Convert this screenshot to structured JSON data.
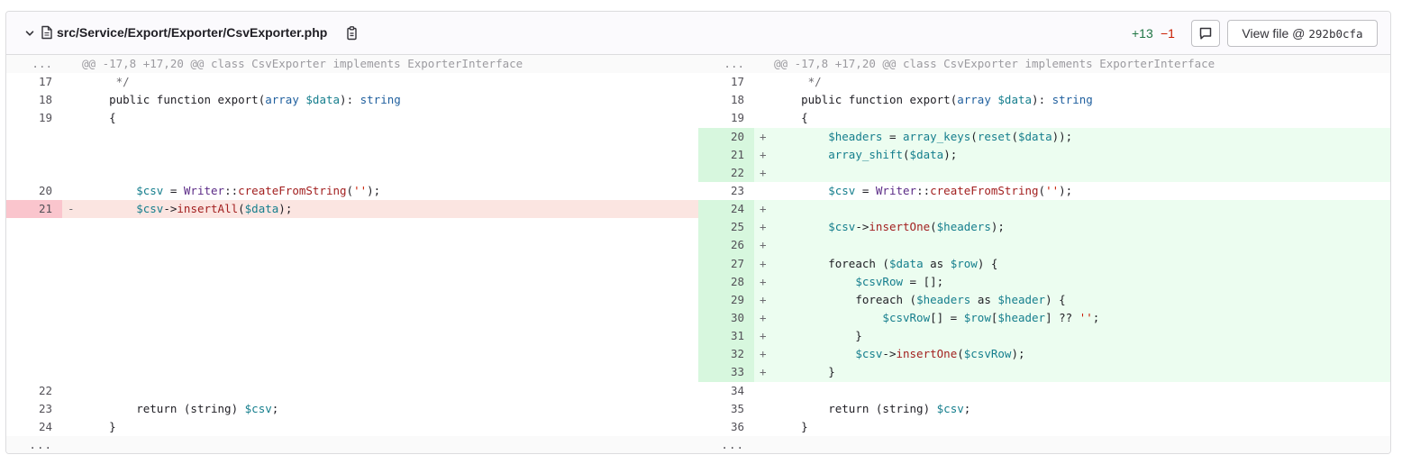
{
  "file": {
    "path": "src/Service/Export/Exporter/CsvExporter.php",
    "additions": "+13",
    "deletions": "−1",
    "view_file_label": "View file @",
    "view_file_sha": "292b0cfa",
    "icons": {
      "collapse": "chevron-down-icon",
      "file": "file-icon",
      "copy": "copy-to-clipboard-icon",
      "comment": "comment-icon"
    }
  },
  "colors": {
    "added_bg": "#ecfdf0",
    "added_line_bg": "#d7f7de",
    "removed_bg": "#fbe5e1",
    "removed_line_bg": "#fac5cd",
    "add_stat": "#217645",
    "del_stat": "#c91c00"
  },
  "hunk": {
    "ellipsis": "...",
    "header": "@@ -17,8 +17,20 @@ class CsvExporter implements ExporterInterface"
  },
  "rows": [
    {
      "type": "ctx",
      "old_num": "17",
      "new_num": "17",
      "old_tokens": [
        [
          "cm",
          "     */"
        ]
      ],
      "new_tokens": [
        [
          "cm",
          "     */"
        ]
      ]
    },
    {
      "type": "ctx",
      "old_num": "18",
      "new_num": "18",
      "old_tokens": [
        [
          "p",
          "    "
        ],
        [
          "kw",
          "public"
        ],
        [
          "p",
          " "
        ],
        [
          "kw",
          "function"
        ],
        [
          "p",
          " export("
        ],
        [
          "ty",
          "array"
        ],
        [
          "p",
          " "
        ],
        [
          "var",
          "$data"
        ],
        [
          "p",
          "): "
        ],
        [
          "ty",
          "string"
        ]
      ],
      "new_tokens": [
        [
          "p",
          "    "
        ],
        [
          "kw",
          "public"
        ],
        [
          "p",
          " "
        ],
        [
          "kw",
          "function"
        ],
        [
          "p",
          " export("
        ],
        [
          "ty",
          "array"
        ],
        [
          "p",
          " "
        ],
        [
          "var",
          "$data"
        ],
        [
          "p",
          "): "
        ],
        [
          "ty",
          "string"
        ]
      ]
    },
    {
      "type": "ctx",
      "old_num": "19",
      "new_num": "19",
      "old_tokens": [
        [
          "p",
          "    {"
        ]
      ],
      "new_tokens": [
        [
          "p",
          "    {"
        ]
      ]
    },
    {
      "type": "addonly",
      "old_num": "",
      "new_num": "20",
      "old_tokens": [],
      "new_tokens": [
        [
          "p",
          "        "
        ],
        [
          "var",
          "$headers"
        ],
        [
          "p",
          " = "
        ],
        [
          "bi",
          "array_keys"
        ],
        [
          "p",
          "("
        ],
        [
          "bi",
          "reset"
        ],
        [
          "p",
          "("
        ],
        [
          "var",
          "$data"
        ],
        [
          "p",
          "));"
        ]
      ]
    },
    {
      "type": "addonly",
      "old_num": "",
      "new_num": "21",
      "old_tokens": [],
      "new_tokens": [
        [
          "p",
          "        "
        ],
        [
          "bi",
          "array_shift"
        ],
        [
          "p",
          "("
        ],
        [
          "var",
          "$data"
        ],
        [
          "p",
          ");"
        ]
      ]
    },
    {
      "type": "addonly",
      "old_num": "",
      "new_num": "22",
      "old_tokens": [],
      "new_tokens": []
    },
    {
      "type": "ctx",
      "old_num": "20",
      "new_num": "23",
      "old_tokens": [
        [
          "p",
          "        "
        ],
        [
          "var",
          "$csv"
        ],
        [
          "p",
          " = "
        ],
        [
          "cls",
          "Writer"
        ],
        [
          "p",
          "::"
        ],
        [
          "fn",
          "createFromString"
        ],
        [
          "p",
          "("
        ],
        [
          "str",
          "''"
        ],
        [
          "p",
          ");"
        ]
      ],
      "new_tokens": [
        [
          "p",
          "        "
        ],
        [
          "var",
          "$csv"
        ],
        [
          "p",
          " = "
        ],
        [
          "cls",
          "Writer"
        ],
        [
          "p",
          "::"
        ],
        [
          "fn",
          "createFromString"
        ],
        [
          "p",
          "("
        ],
        [
          "str",
          "''"
        ],
        [
          "p",
          ");"
        ]
      ]
    },
    {
      "type": "change",
      "old_num": "21",
      "new_num": "24",
      "old_tokens": [
        [
          "p",
          "        "
        ],
        [
          "var",
          "$csv"
        ],
        [
          "p",
          "->"
        ],
        [
          "fn",
          "insertAll"
        ],
        [
          "p",
          "("
        ],
        [
          "var",
          "$data"
        ],
        [
          "p",
          ");"
        ]
      ],
      "new_tokens": []
    },
    {
      "type": "addonly",
      "old_num": "",
      "new_num": "25",
      "old_tokens": [],
      "new_tokens": [
        [
          "p",
          "        "
        ],
        [
          "var",
          "$csv"
        ],
        [
          "p",
          "->"
        ],
        [
          "fn",
          "insertOne"
        ],
        [
          "p",
          "("
        ],
        [
          "var",
          "$headers"
        ],
        [
          "p",
          ");"
        ]
      ]
    },
    {
      "type": "addonly",
      "old_num": "",
      "new_num": "26",
      "old_tokens": [],
      "new_tokens": []
    },
    {
      "type": "addonly",
      "old_num": "",
      "new_num": "27",
      "old_tokens": [],
      "new_tokens": [
        [
          "p",
          "        "
        ],
        [
          "kw",
          "foreach"
        ],
        [
          "p",
          " ("
        ],
        [
          "var",
          "$data"
        ],
        [
          "p",
          " "
        ],
        [
          "kw",
          "as"
        ],
        [
          "p",
          " "
        ],
        [
          "var",
          "$row"
        ],
        [
          "p",
          ") {"
        ]
      ]
    },
    {
      "type": "addonly",
      "old_num": "",
      "new_num": "28",
      "old_tokens": [],
      "new_tokens": [
        [
          "p",
          "            "
        ],
        [
          "var",
          "$csvRow"
        ],
        [
          "p",
          " = [];"
        ]
      ]
    },
    {
      "type": "addonly",
      "old_num": "",
      "new_num": "29",
      "old_tokens": [],
      "new_tokens": [
        [
          "p",
          "            "
        ],
        [
          "kw",
          "foreach"
        ],
        [
          "p",
          " ("
        ],
        [
          "var",
          "$headers"
        ],
        [
          "p",
          " "
        ],
        [
          "kw",
          "as"
        ],
        [
          "p",
          " "
        ],
        [
          "var",
          "$header"
        ],
        [
          "p",
          ") {"
        ]
      ]
    },
    {
      "type": "addonly",
      "old_num": "",
      "new_num": "30",
      "old_tokens": [],
      "new_tokens": [
        [
          "p",
          "                "
        ],
        [
          "var",
          "$csvRow"
        ],
        [
          "p",
          "[] = "
        ],
        [
          "var",
          "$row"
        ],
        [
          "p",
          "["
        ],
        [
          "var",
          "$header"
        ],
        [
          "p",
          "] ?? "
        ],
        [
          "str",
          "''"
        ],
        [
          "p",
          ";"
        ]
      ]
    },
    {
      "type": "addonly",
      "old_num": "",
      "new_num": "31",
      "old_tokens": [],
      "new_tokens": [
        [
          "p",
          "            }"
        ]
      ]
    },
    {
      "type": "addonly",
      "old_num": "",
      "new_num": "32",
      "old_tokens": [],
      "new_tokens": [
        [
          "p",
          "            "
        ],
        [
          "var",
          "$csv"
        ],
        [
          "p",
          "->"
        ],
        [
          "fn",
          "insertOne"
        ],
        [
          "p",
          "("
        ],
        [
          "var",
          "$csvRow"
        ],
        [
          "p",
          ");"
        ]
      ]
    },
    {
      "type": "addonly",
      "old_num": "",
      "new_num": "33",
      "old_tokens": [],
      "new_tokens": [
        [
          "p",
          "        }"
        ]
      ]
    },
    {
      "type": "ctx",
      "old_num": "22",
      "new_num": "34",
      "old_tokens": [],
      "new_tokens": []
    },
    {
      "type": "ctx",
      "old_num": "23",
      "new_num": "35",
      "old_tokens": [
        [
          "p",
          "        "
        ],
        [
          "kw",
          "return"
        ],
        [
          "p",
          " (string) "
        ],
        [
          "var",
          "$csv"
        ],
        [
          "p",
          ";"
        ]
      ],
      "new_tokens": [
        [
          "p",
          "        "
        ],
        [
          "kw",
          "return"
        ],
        [
          "p",
          " (string) "
        ],
        [
          "var",
          "$csv"
        ],
        [
          "p",
          ";"
        ]
      ]
    },
    {
      "type": "ctx",
      "old_num": "24",
      "new_num": "36",
      "old_tokens": [
        [
          "p",
          "    }"
        ]
      ],
      "new_tokens": [
        [
          "p",
          "    }"
        ]
      ]
    }
  ],
  "signs": {
    "add": "+",
    "del": "-"
  }
}
